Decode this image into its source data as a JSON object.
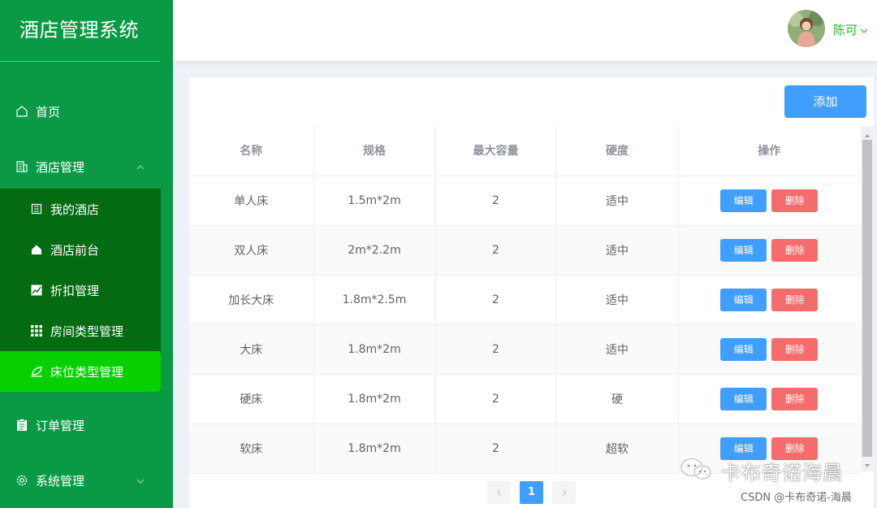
{
  "app": {
    "title": "酒店管理系统"
  },
  "sidebar": {
    "items": [
      {
        "label": "首页",
        "icon": "home-icon"
      },
      {
        "label": "酒店管理",
        "icon": "building-icon",
        "expanded": true
      },
      {
        "label": "订单管理",
        "icon": "clipboard-icon"
      },
      {
        "label": "系统管理",
        "icon": "gear-icon"
      }
    ],
    "submenu": [
      {
        "label": "我的酒店",
        "icon": "hotel-icon"
      },
      {
        "label": "酒店前台",
        "icon": "house-icon"
      },
      {
        "label": "折扣管理",
        "icon": "chart-icon"
      },
      {
        "label": "房间类型管理",
        "icon": "grid-icon"
      },
      {
        "label": "床位类型管理",
        "icon": "leaf-icon",
        "active": true
      }
    ]
  },
  "header": {
    "user_name": "陈可"
  },
  "toolbar": {
    "add_label": "添加"
  },
  "table": {
    "columns": [
      "名称",
      "规格",
      "最大容量",
      "硬度",
      "操作"
    ],
    "rows": [
      {
        "name": "单人床",
        "spec": "1.5m*2m",
        "capacity": "2",
        "hardness": "适中"
      },
      {
        "name": "双人床",
        "spec": "2m*2.2m",
        "capacity": "2",
        "hardness": "适中"
      },
      {
        "name": "加长大床",
        "spec": "1.8m*2.5m",
        "capacity": "2",
        "hardness": "适中"
      },
      {
        "name": "大床",
        "spec": "1.8m*2m",
        "capacity": "2",
        "hardness": "适中"
      },
      {
        "name": "硬床",
        "spec": "1.8m*2m",
        "capacity": "2",
        "hardness": "硬"
      },
      {
        "name": "软床",
        "spec": "1.8m*2m",
        "capacity": "2",
        "hardness": "超软"
      }
    ],
    "edit_label": "编辑",
    "delete_label": "删除"
  },
  "pagination": {
    "current_page": "1"
  },
  "watermark": {
    "text": "卡布奇诺海晨",
    "csdn": "CSDN @卡布奇诺-海晨"
  },
  "colors": {
    "sidebar": "#0a9a45",
    "submenu": "#046b12",
    "active": "#06d000",
    "primary": "#409eff",
    "danger": "#f56c6c"
  }
}
